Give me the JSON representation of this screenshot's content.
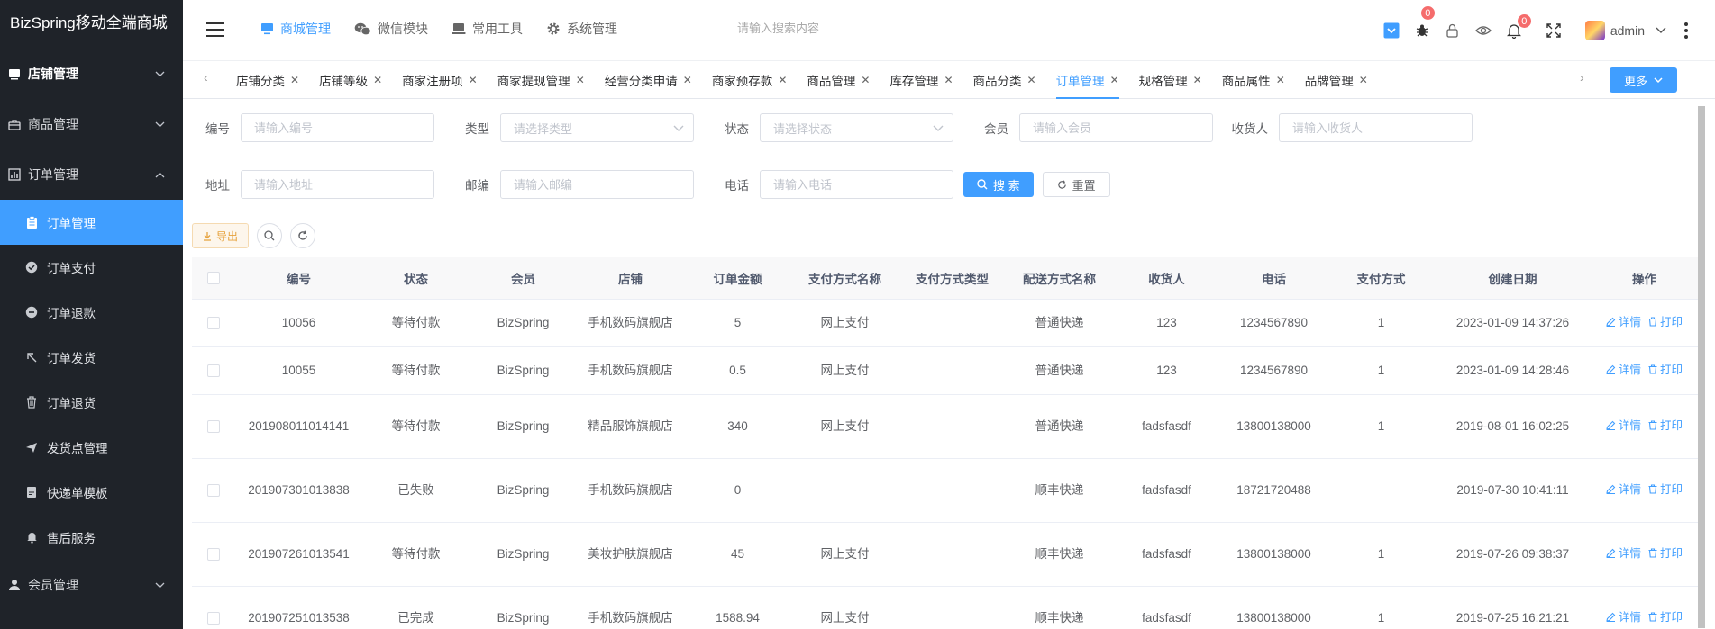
{
  "app": {
    "title": "BizSpring移动全端商城"
  },
  "sidebar": {
    "groups_top": [
      {
        "label": "店铺管理",
        "icon": "store-icon",
        "bold": true,
        "arrow": "⌄"
      },
      {
        "label": "商品管理",
        "icon": "briefcase-icon",
        "bold": false,
        "arrow": "⌄"
      },
      {
        "label": "订单管理",
        "icon": "chart-icon",
        "bold": false,
        "arrow": "⌃"
      }
    ],
    "sub_items": [
      {
        "label": "订单管理",
        "icon": "clipboard-icon",
        "active": true
      },
      {
        "label": "订单支付",
        "icon": "check-circle-icon",
        "active": false
      },
      {
        "label": "订单退款",
        "icon": "minus-circle-icon",
        "active": false
      },
      {
        "label": "订单发货",
        "icon": "arrow-up-left-icon",
        "active": false
      },
      {
        "label": "订单退货",
        "icon": "trash-icon",
        "active": false
      },
      {
        "label": "发货点管理",
        "icon": "send-icon",
        "active": false
      },
      {
        "label": "快递单模板",
        "icon": "document-icon",
        "active": false
      },
      {
        "label": "售后服务",
        "icon": "bell-icon",
        "active": false
      }
    ],
    "groups_bottom": [
      {
        "label": "会员管理",
        "icon": "user-icon",
        "arrow": "⌄"
      }
    ]
  },
  "header": {
    "nav": [
      {
        "label": "商城管理",
        "icon": "monitor-icon",
        "active": true
      },
      {
        "label": "微信模块",
        "icon": "wechat-icon",
        "active": false
      },
      {
        "label": "常用工具",
        "icon": "laptop-icon",
        "active": false
      },
      {
        "label": "系统管理",
        "icon": "gear-icon",
        "active": false
      }
    ],
    "search_placeholder": "请输入搜索内容",
    "bug_badge": "0",
    "bell_badge": "0",
    "username": "admin"
  },
  "tabs": {
    "items": [
      {
        "label": "店铺分类",
        "active": false
      },
      {
        "label": "店铺等级",
        "active": false
      },
      {
        "label": "商家注册项",
        "active": false
      },
      {
        "label": "商家提现管理",
        "active": false
      },
      {
        "label": "经营分类申请",
        "active": false
      },
      {
        "label": "商家预存款",
        "active": false
      },
      {
        "label": "商品管理",
        "active": false
      },
      {
        "label": "库存管理",
        "active": false
      },
      {
        "label": "商品分类",
        "active": false
      },
      {
        "label": "订单管理",
        "active": true
      },
      {
        "label": "规格管理",
        "active": false
      },
      {
        "label": "商品属性",
        "active": false
      },
      {
        "label": "品牌管理",
        "active": false
      }
    ],
    "more_label": "更多"
  },
  "filters": {
    "code": {
      "label": "编号",
      "placeholder": "请输入编号"
    },
    "type": {
      "label": "类型",
      "placeholder": "请选择类型"
    },
    "status": {
      "label": "状态",
      "placeholder": "请选择状态"
    },
    "member": {
      "label": "会员",
      "placeholder": "请输入会员"
    },
    "receiver": {
      "label": "收货人",
      "placeholder": "请输入收货人"
    },
    "address": {
      "label": "地址",
      "placeholder": "请输入地址"
    },
    "zipcode": {
      "label": "邮编",
      "placeholder": "请输入邮编"
    },
    "phone": {
      "label": "电话",
      "placeholder": "请输入电话"
    },
    "search_label": "搜 索",
    "reset_label": "重置"
  },
  "toolbar": {
    "export_label": "导出"
  },
  "table": {
    "columns": [
      "编号",
      "状态",
      "会员",
      "店铺",
      "订单金额",
      "支付方式名称",
      "支付方式类型",
      "配送方式名称",
      "收货人",
      "电话",
      "支付方式",
      "创建日期",
      "操作"
    ],
    "rows": [
      {
        "code": "10056",
        "status": "等待付款",
        "member": "BizSpring",
        "store": "手机数码旗舰店",
        "amount": "5",
        "pay_name": "网上支付",
        "pay_type": "",
        "ship": "普通快递",
        "receiver": "123",
        "phone": "1234567890",
        "pay_method": "1",
        "date": "2023-01-09 14:37:26"
      },
      {
        "code": "10055",
        "status": "等待付款",
        "member": "BizSpring",
        "store": "手机数码旗舰店",
        "amount": "0.5",
        "pay_name": "网上支付",
        "pay_type": "",
        "ship": "普通快递",
        "receiver": "123",
        "phone": "1234567890",
        "pay_method": "1",
        "date": "2023-01-09 14:28:46"
      },
      {
        "code": "201908011014141",
        "status": "等待付款",
        "member": "BizSpring",
        "store": "精品服饰旗舰店",
        "amount": "340",
        "pay_name": "网上支付",
        "pay_type": "",
        "ship": "普通快递",
        "receiver": "fadsfasdf",
        "phone": "13800138000",
        "pay_method": "1",
        "date": "2019-08-01 16:02:25"
      },
      {
        "code": "201907301013838",
        "status": "已失败",
        "member": "BizSpring",
        "store": "手机数码旗舰店",
        "amount": "0",
        "pay_name": "",
        "pay_type": "",
        "ship": "顺丰快递",
        "receiver": "fadsfasdf",
        "phone": "18721720488",
        "pay_method": "",
        "date": "2019-07-30 10:41:11"
      },
      {
        "code": "201907261013541",
        "status": "等待付款",
        "member": "BizSpring",
        "store": "美妆护肤旗舰店",
        "amount": "45",
        "pay_name": "网上支付",
        "pay_type": "",
        "ship": "顺丰快递",
        "receiver": "fadsfasdf",
        "phone": "13800138000",
        "pay_method": "1",
        "date": "2019-07-26 09:38:37"
      },
      {
        "code": "201907251013538",
        "status": "已完成",
        "member": "BizSpring",
        "store": "手机数码旗舰店",
        "amount": "1588.94",
        "pay_name": "网上支付",
        "pay_type": "",
        "ship": "顺丰快递",
        "receiver": "fadsfasdf",
        "phone": "13800138000",
        "pay_method": "1",
        "date": "2019-07-25 16:21:21"
      }
    ],
    "detail_label": "详情",
    "print_label": "打印"
  },
  "colors": {
    "accent": "#409eff",
    "sidebar_bg": "#1f2329",
    "warning": "#e6a23c",
    "danger": "#f56c6c"
  }
}
